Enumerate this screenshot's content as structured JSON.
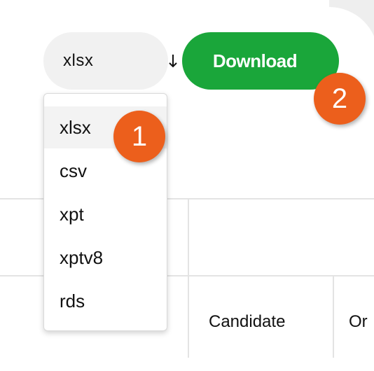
{
  "format_select": {
    "value": "xlsx",
    "icon": "arrow-down-icon"
  },
  "download_button": {
    "label": "Download"
  },
  "dropdown": {
    "options": [
      {
        "label": "xlsx",
        "selected": true
      },
      {
        "label": "csv"
      },
      {
        "label": "xpt"
      },
      {
        "label": "xptv8"
      },
      {
        "label": "rds"
      }
    ]
  },
  "badges": {
    "first": "1",
    "second": "2"
  },
  "table": {
    "headers": [
      "Candidate",
      "Or"
    ]
  },
  "colors": {
    "accent_green": "#1aa63a",
    "badge_orange": "#ec5f1c",
    "select_bg": "#f1f1f1"
  }
}
